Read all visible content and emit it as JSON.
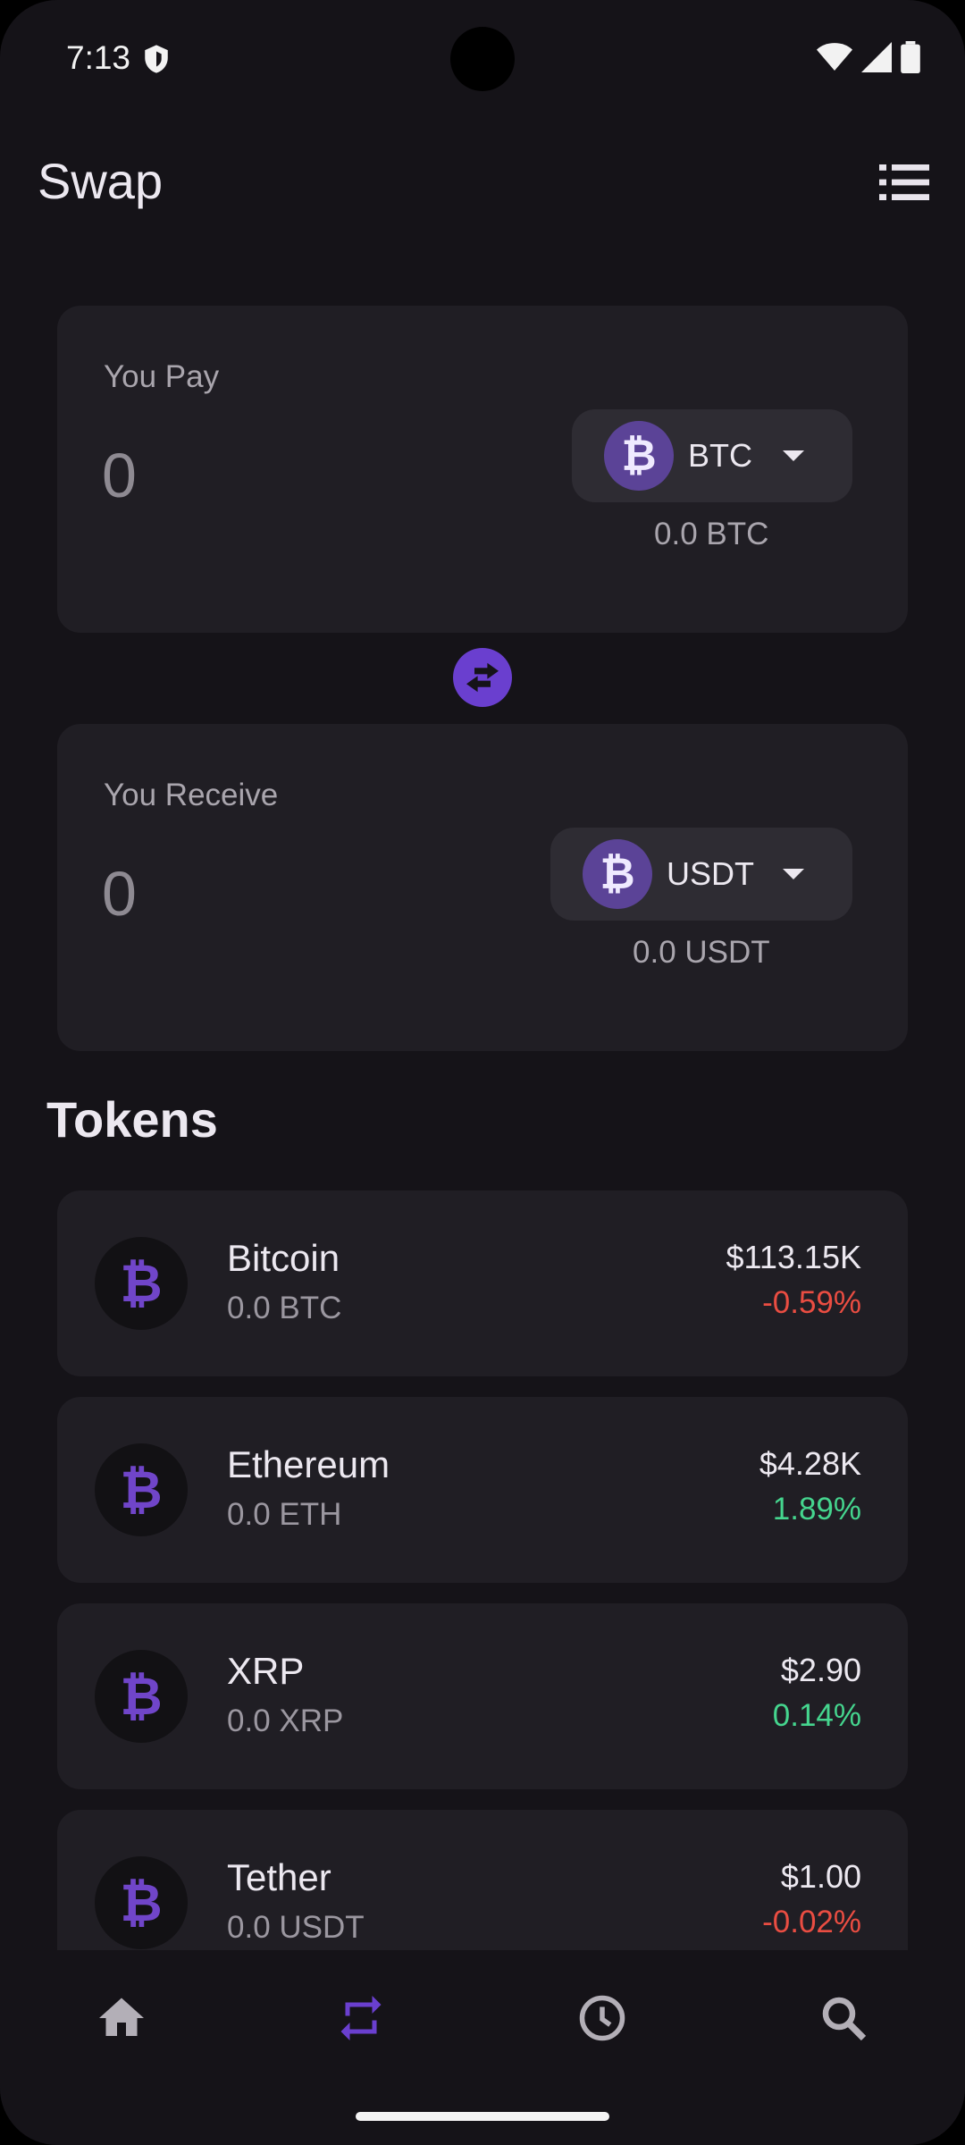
{
  "status_bar": {
    "time": "7:13"
  },
  "appbar": {
    "title": "Swap",
    "menu_icon": "list-icon"
  },
  "pay": {
    "label": "You Pay",
    "amount": "0",
    "token": "BTC",
    "token_icon": "bitcoin-icon",
    "balance": "0.0 BTC"
  },
  "receive": {
    "label": "You Receive",
    "amount": "0",
    "token": "USDT",
    "token_icon": "bitcoin-icon",
    "balance": "0.0 USDT"
  },
  "swap_icon": "swap-arrows-icon",
  "tokens": {
    "title": "Tokens",
    "items": [
      {
        "name": "Bitcoin",
        "balance": "0.0 BTC",
        "price": "$113.15K",
        "change": "-0.59%",
        "trend": "negative"
      },
      {
        "name": "Ethereum",
        "balance": "0.0 ETH",
        "price": "$4.28K",
        "change": "1.89%",
        "trend": "positive"
      },
      {
        "name": "XRP",
        "balance": "0.0 XRP",
        "price": "$2.90",
        "change": "0.14%",
        "trend": "positive"
      },
      {
        "name": "Tether",
        "balance": "0.0 USDT",
        "price": "$1.00",
        "change": "-0.02%",
        "trend": "negative"
      }
    ]
  },
  "bottom_nav": {
    "items": [
      "home-icon",
      "swap-icon",
      "history-icon",
      "search-icon"
    ],
    "active": "swap-icon",
    "active_color": "#6a3fcf"
  },
  "colors": {
    "accent": "#6a3fcf",
    "negative": "#ea4d42",
    "positive": "#45d58e",
    "background": "#151318",
    "card": "#201e24"
  }
}
